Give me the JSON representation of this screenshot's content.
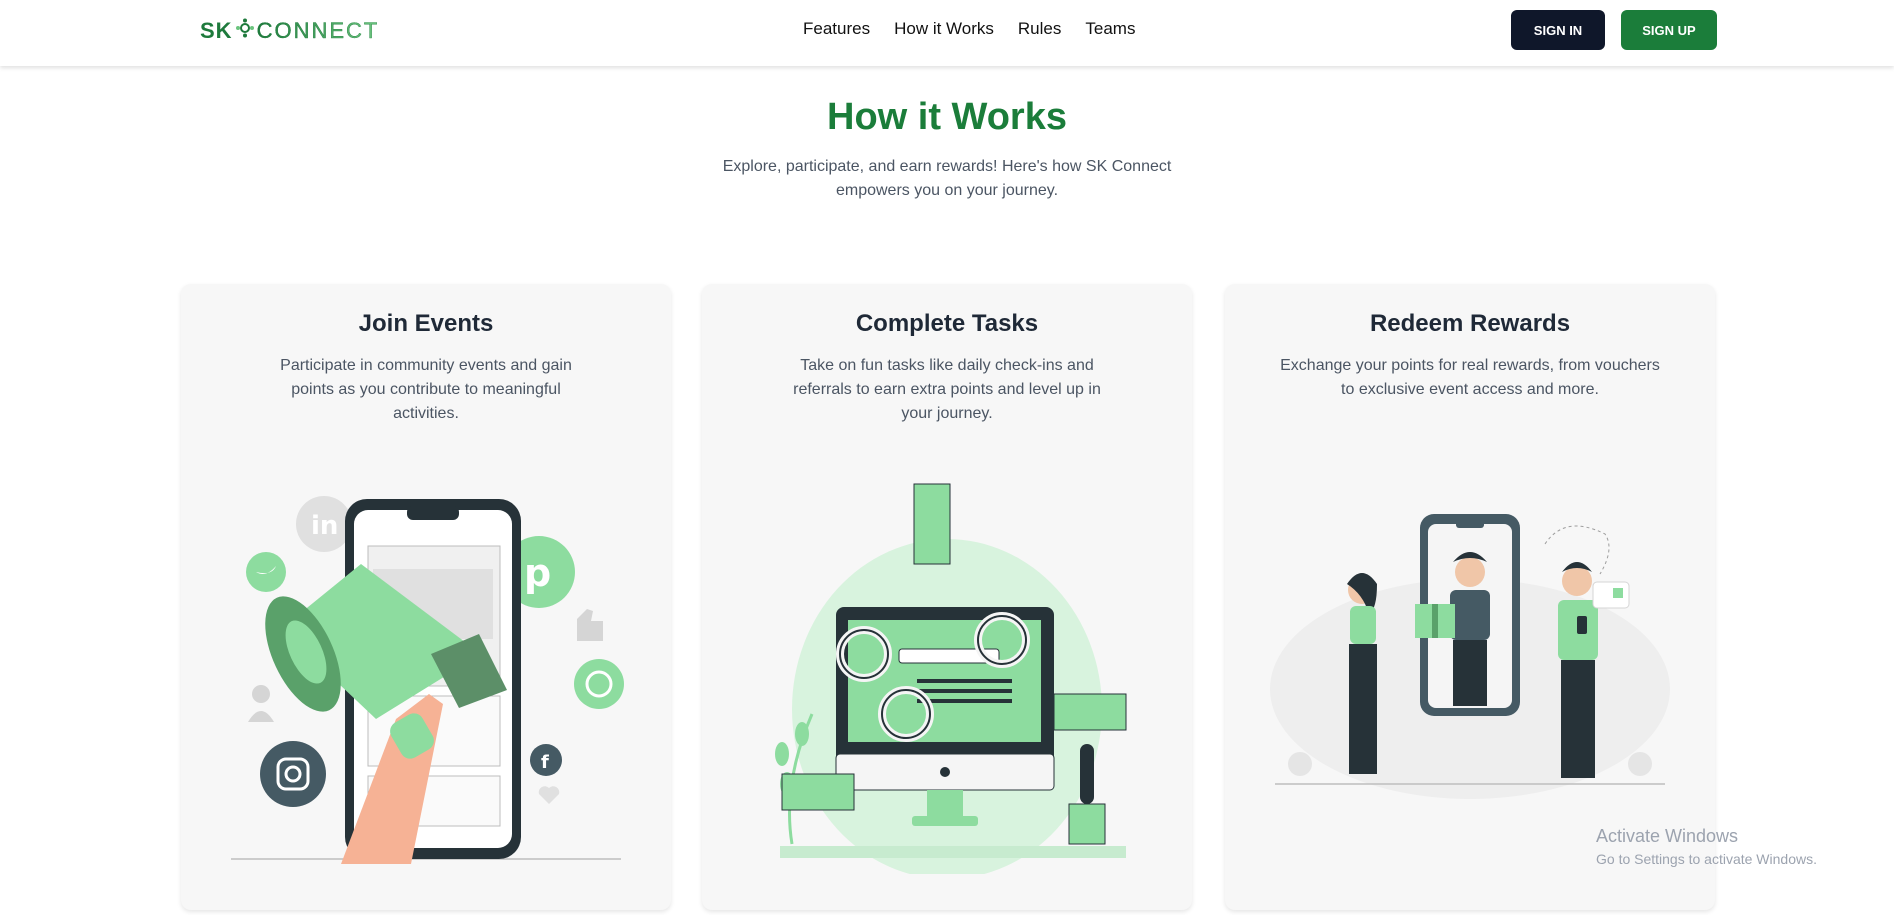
{
  "header": {
    "logo_sk": "SK",
    "logo_connect": "CONNECT",
    "nav": [
      "Features",
      "How it Works",
      "Rules",
      "Teams"
    ],
    "signin_label": "SIGN IN",
    "signup_label": "SIGN UP"
  },
  "hero": {
    "title": "How it Works",
    "subtitle": "Explore, participate, and earn rewards! Here's how SK Connect empowers you on your journey."
  },
  "cards": [
    {
      "title": "Join Events",
      "text": "Participate in community events and gain points as you contribute to meaningful activities."
    },
    {
      "title": "Complete Tasks",
      "text": "Take on fun tasks like daily check-ins and referrals to earn extra points and level up in your journey."
    },
    {
      "title": "Redeem Rewards",
      "text": "Exchange your points for real rewards, from vouchers to exclusive event access and more."
    }
  ],
  "watermark": {
    "line1": "Activate Windows",
    "line2": "Go to Settings to activate Windows."
  },
  "colors": {
    "brand_green": "#1b7d3a",
    "accent_green": "#8ddc9f",
    "dark": "#0f172a"
  }
}
